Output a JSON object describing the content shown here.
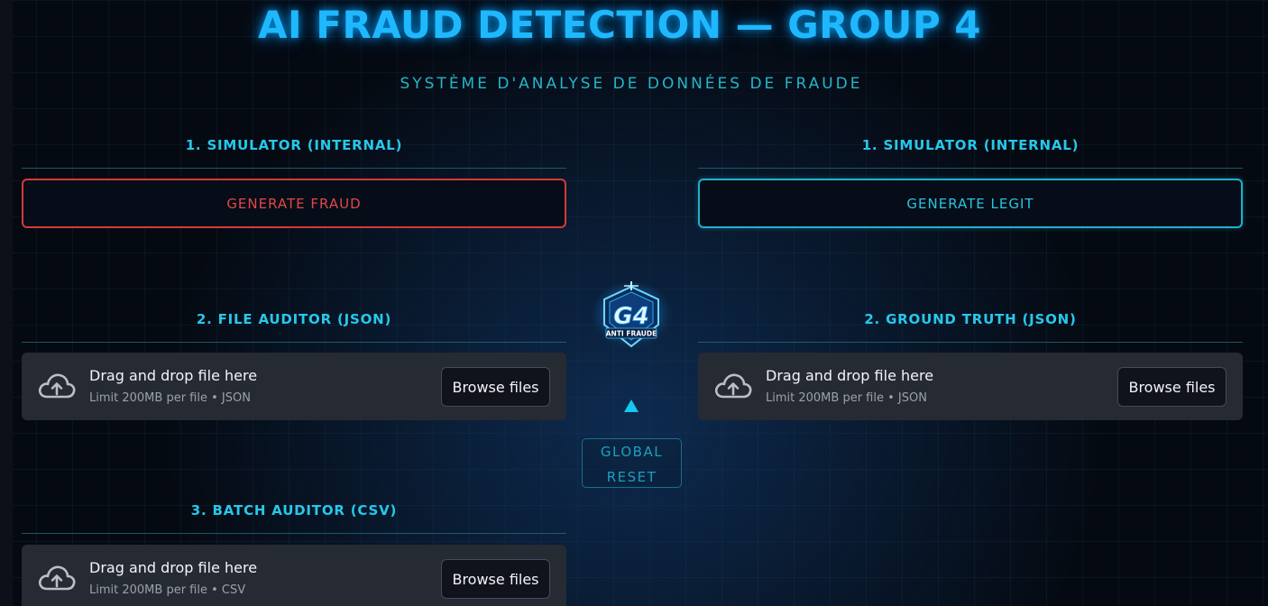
{
  "header": {
    "title": "AI FRAUD DETECTION — GROUP 4",
    "subtitle": "SYSTÈME D'ANALYSE DE DONNÉES DE FRAUDE"
  },
  "left_column": {
    "simulator": {
      "title": "1. SIMULATOR (INTERNAL)",
      "button_label": "GENERATE FRAUD"
    },
    "file_auditor": {
      "title": "2. FILE AUDITOR (JSON)",
      "drop_text": "Drag and drop file here",
      "hint": "Limit 200MB per file • JSON",
      "browse_label": "Browse files"
    },
    "batch_auditor": {
      "title": "3. BATCH AUDITOR (CSV)",
      "drop_text": "Drag and drop file here",
      "hint": "Limit 200MB per file • CSV",
      "browse_label": "Browse files"
    }
  },
  "right_column": {
    "simulator": {
      "title": "1. SIMULATOR (INTERNAL)",
      "button_label": "GENERATE LEGIT"
    },
    "ground_truth": {
      "title": "2. GROUND TRUTH (JSON)",
      "drop_text": "Drag and drop file here",
      "hint": "Limit 200MB per file • JSON",
      "browse_label": "Browse files"
    }
  },
  "center": {
    "logo": {
      "mark": "G4",
      "tagline": "ANTI FRAUDE"
    },
    "arrow_icon": "triangle-up-icon",
    "reset_label": "GLOBAL RESET"
  },
  "colors": {
    "accent_cyan": "#1fb8ff",
    "fraud_red": "#d43a3a",
    "legit_cyan": "#1fb1cf",
    "background": "#050a12"
  }
}
